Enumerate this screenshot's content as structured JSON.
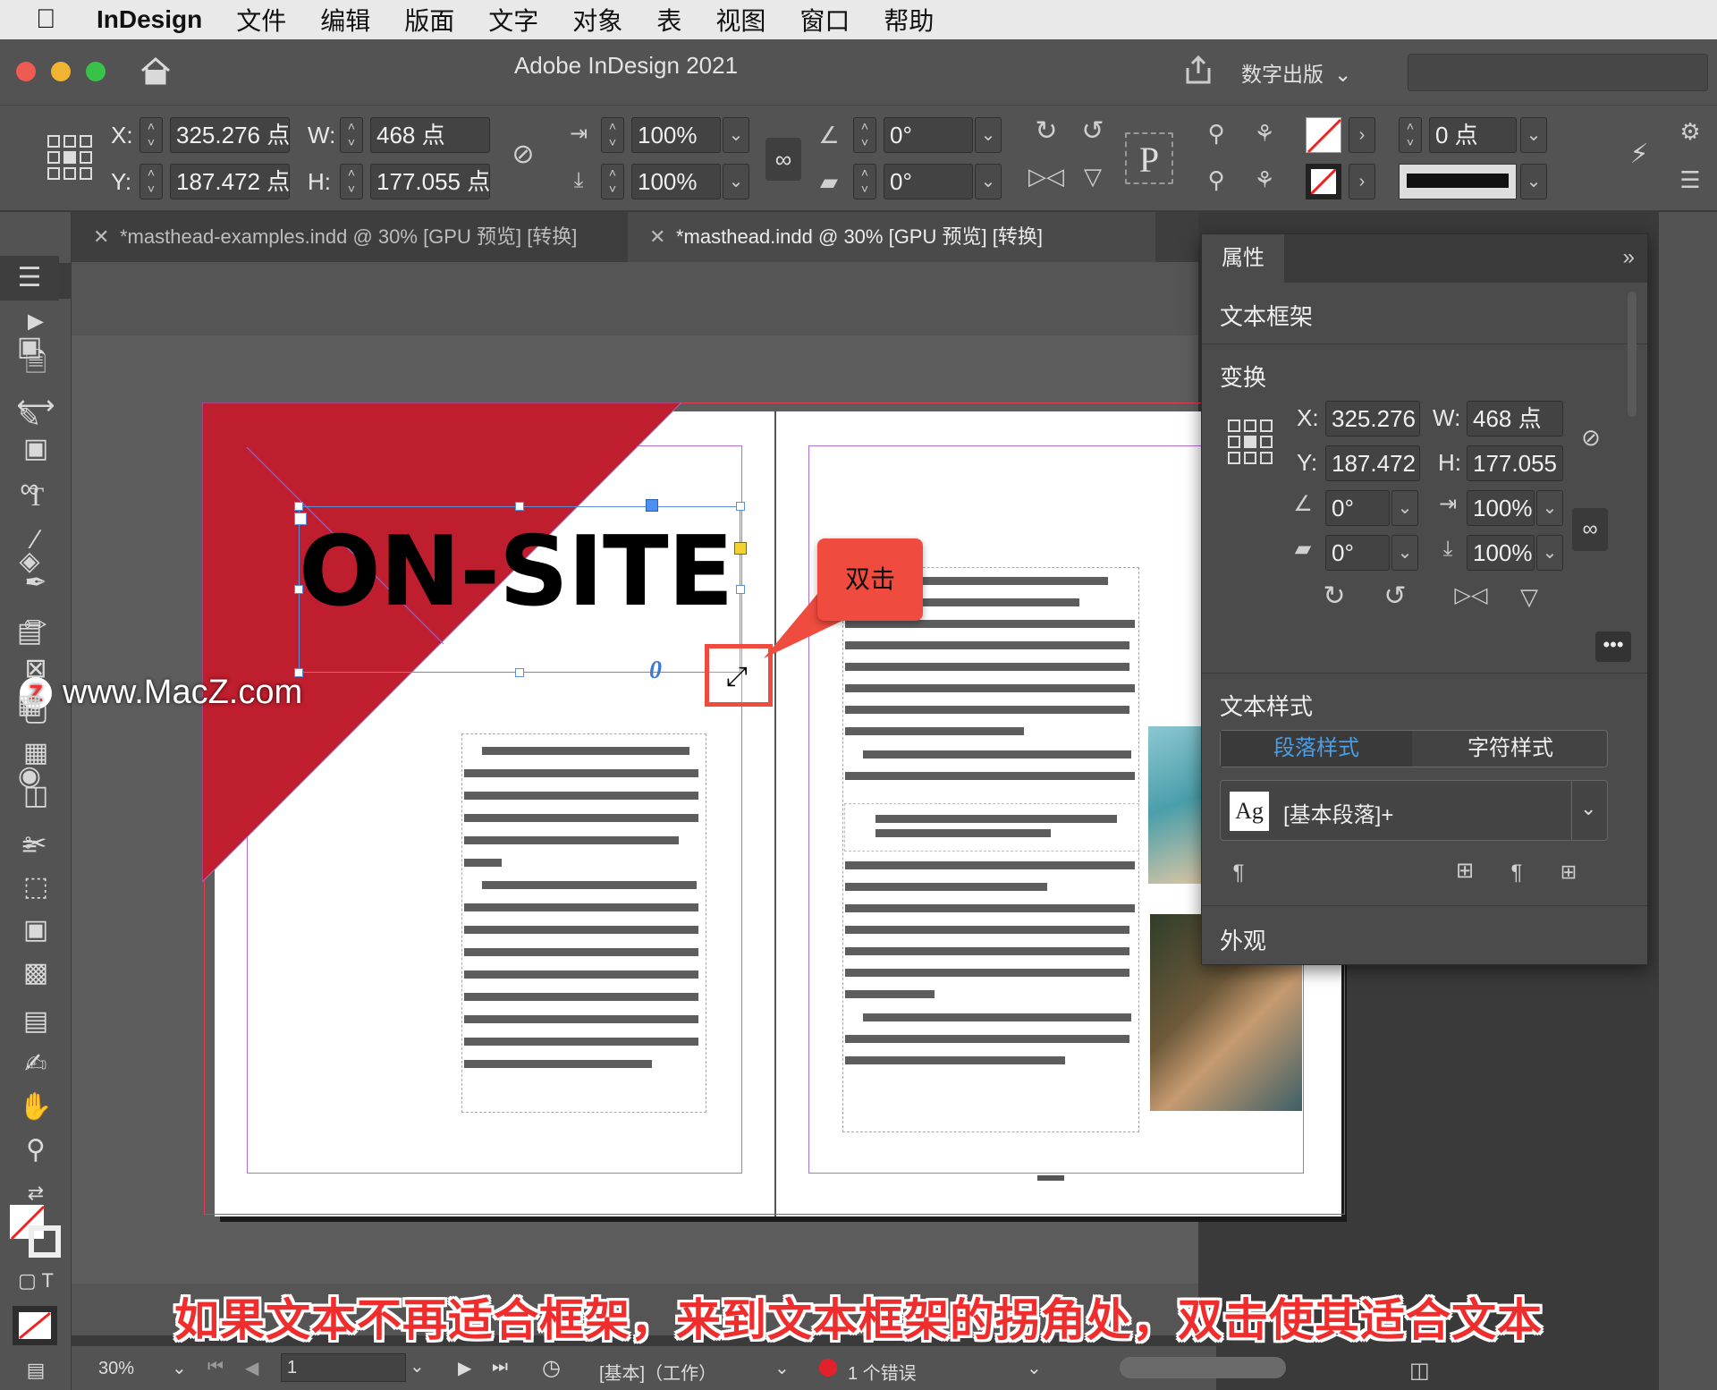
{
  "menubar": {
    "app_name": "InDesign",
    "items": [
      "文件",
      "编辑",
      "版面",
      "文字",
      "对象",
      "表",
      "视图",
      "窗口",
      "帮助"
    ]
  },
  "window": {
    "title": "Adobe InDesign 2021",
    "workspace": "数字出版",
    "search_value": ""
  },
  "control": {
    "x_label": "X:",
    "x_value": "325.276 点",
    "y_label": "Y:",
    "y_value": "187.472 点",
    "w_label": "W:",
    "w_value": "468 点",
    "h_label": "H:",
    "h_value": "177.055 点",
    "scale_x": "100%",
    "scale_y": "100%",
    "rotate": "0°",
    "shear": "0°",
    "stroke_weight": "0 点",
    "p_glyph": "P"
  },
  "tabs": [
    {
      "label": "*masthead-examples.indd @ 30% [GPU 预览] [转换]",
      "active": false
    },
    {
      "label": "*masthead.indd @ 30% [GPU 预览] [转换]",
      "active": true
    }
  ],
  "document": {
    "headline": "ON-SITE",
    "overset_marker": "0"
  },
  "callout": "双击",
  "watermark": "www.MacZ.com",
  "subtitle": "如果文本不再适合框架，来到文本框架的拐角处，双击使其适合文本",
  "properties": {
    "tab": "属性",
    "object_type": "文本框架",
    "transform_title": "变换",
    "x_label": "X:",
    "x_value": "325.276",
    "y_label": "Y:",
    "y_value": "187.472",
    "w_label": "W:",
    "w_value": "468 点",
    "h_label": "H:",
    "h_value": "177.055",
    "rotate": "0°",
    "shear": "0°",
    "scale_x": "100%",
    "scale_y": "100%",
    "text_style_title": "文本样式",
    "para_style_tab": "段落样式",
    "char_style_tab": "字符样式",
    "style_preview": "Ag",
    "style_value": "[基本段落]+",
    "appearance_title": "外观"
  },
  "status": {
    "zoom": "30%",
    "page": "1",
    "preflight_profile": "[基本]（工作）",
    "errors": "1 个错误"
  },
  "colors": {
    "accent_red": "#be1e2d",
    "callout_red": "#ef4b3f",
    "selection_blue": "#5b8fd9",
    "active_tab_blue": "#4a9ee6"
  }
}
